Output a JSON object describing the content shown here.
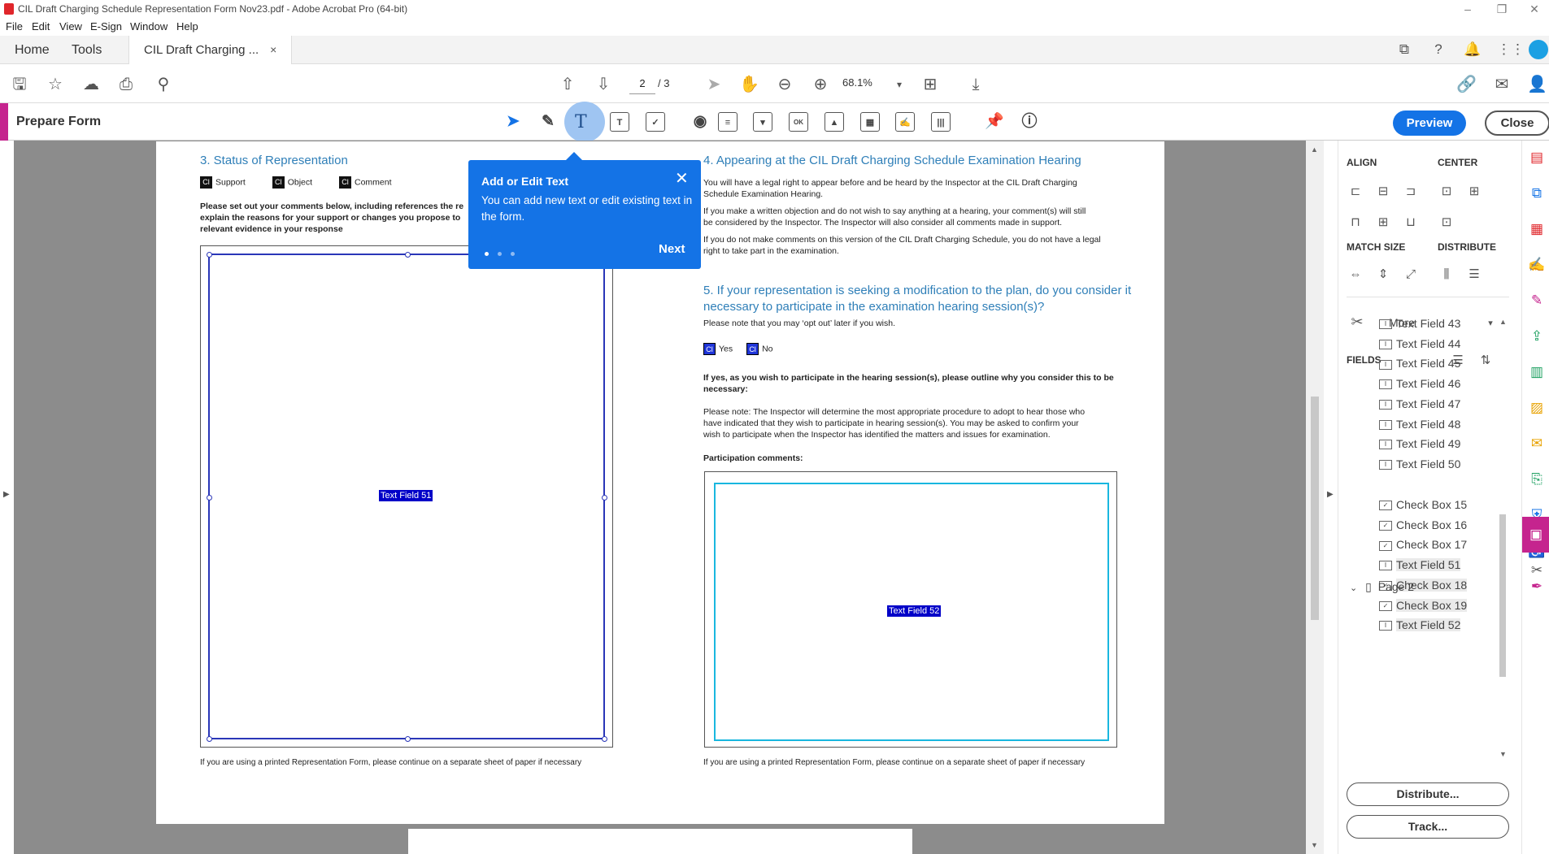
{
  "window": {
    "title": "CIL Draft Charging Schedule Representation Form Nov23.pdf - Adobe Acrobat Pro (64-bit)",
    "controls": [
      "–",
      "❐",
      "✕"
    ]
  },
  "menu": [
    "File",
    "Edit",
    "View",
    "E-Sign",
    "Window",
    "Help"
  ],
  "tabs": {
    "home": "Home",
    "tools": "Tools",
    "document": "CIL Draft Charging ...",
    "close_glyph": "×"
  },
  "toolbar": {
    "page_current": "2",
    "page_total": "/ 3",
    "zoom": "68.1%"
  },
  "prepare_form": {
    "title": "Prepare Form",
    "preview_label": "Preview",
    "close_label": "Close",
    "field_tools": [
      "select",
      "edit-text-fields",
      "add-text",
      "text-field",
      "check-box",
      "radio-button",
      "list-box",
      "dropdown",
      "button",
      "image",
      "date",
      "signature",
      "barcode",
      "pin",
      "help"
    ],
    "accent": "#c5248e",
    "brand": "#1473e6"
  },
  "tooltip": {
    "title": "Add or Edit Text",
    "body": "You can add new text or edit existing text in the form.",
    "next": "Next",
    "close_glyph": "✕",
    "step": 1,
    "steps": 3
  },
  "doc": {
    "sec3": {
      "heading": "3. Status of Representation",
      "options": [
        "Support",
        "Object",
        "Comment"
      ],
      "instructions_l1": "Please set out your comments below, including references the re",
      "instructions_l2": "explain the reasons for your support or changes you propose to",
      "instructions_l3": "relevant evidence in your response",
      "field_label": "Text Field 51"
    },
    "sec4": {
      "heading": "4. Appearing at the CIL Draft Charging Schedule Examination Hearing",
      "p1_l1": "You will have a legal right to appear before and be heard by the Inspector at the CIL Draft Charging",
      "p1_l2": "Schedule Examination Hearing.",
      "p2_l1": "If you make a written objection and do not wish to say anything at a hearing, your comment(s) will still",
      "p2_l2": "be considered by the Inspector.   The Inspector will also consider all comments made in support.",
      "p3_l1": "If you do not make comments on this version of the CIL Draft Charging Schedule, you do not have a legal",
      "p3_l2": "right to take part in the examination."
    },
    "sec5": {
      "heading_l1": "5. If your representation is seeking a modification to the plan, do you consider it",
      "heading_l2": "necessary to participate in the examination hearing session(s)?",
      "note": "Please note that you may ‘opt out’ later if you wish.",
      "yes": "Yes",
      "no": "No",
      "q_l1": "If yes, as you wish to participate in the hearing session(s), please outline why you consider this to be",
      "q_l2": "necessary:",
      "p_l1": "Please note: The Inspector will determine the most appropriate procedure to adopt to hear those who",
      "p_l2": "have indicated that they wish to participate in hearing session(s). You may be asked to confirm your",
      "p_l3": "wish to participate when the Inspector has identified the matters and issues for examination.",
      "comments_label": "Participation comments:",
      "field_label": "Text Field 52"
    },
    "footer_note": "If you are using a printed Representation Form, please continue on a separate sheet of paper if necessary",
    "checkbox_glyph": "Cl"
  },
  "panel": {
    "align": "ALIGN",
    "center": "CENTER",
    "match_size": "MATCH SIZE",
    "distribute": "DISTRIBUTE",
    "more": "More",
    "fields": "FIELDS",
    "page_group": "Page 2",
    "items": [
      {
        "label": "Text Field 43",
        "type": "text"
      },
      {
        "label": "Text Field 44",
        "type": "text"
      },
      {
        "label": "Text Field 45",
        "type": "text"
      },
      {
        "label": "Text Field 46",
        "type": "text"
      },
      {
        "label": "Text Field 47",
        "type": "text"
      },
      {
        "label": "Text Field 48",
        "type": "text"
      },
      {
        "label": "Text Field 49",
        "type": "text"
      },
      {
        "label": "Text Field 50",
        "type": "text"
      }
    ],
    "page2_items": [
      {
        "label": "Check Box 15",
        "type": "check"
      },
      {
        "label": "Check Box 16",
        "type": "check"
      },
      {
        "label": "Check Box 17",
        "type": "check"
      },
      {
        "label": "Text Field 51",
        "type": "text"
      },
      {
        "label": "Check Box 18",
        "type": "check"
      },
      {
        "label": "Check Box 19",
        "type": "check"
      },
      {
        "label": "Text Field 52",
        "type": "text"
      }
    ],
    "distribute_btn": "Distribute...",
    "track_btn": "Track..."
  }
}
